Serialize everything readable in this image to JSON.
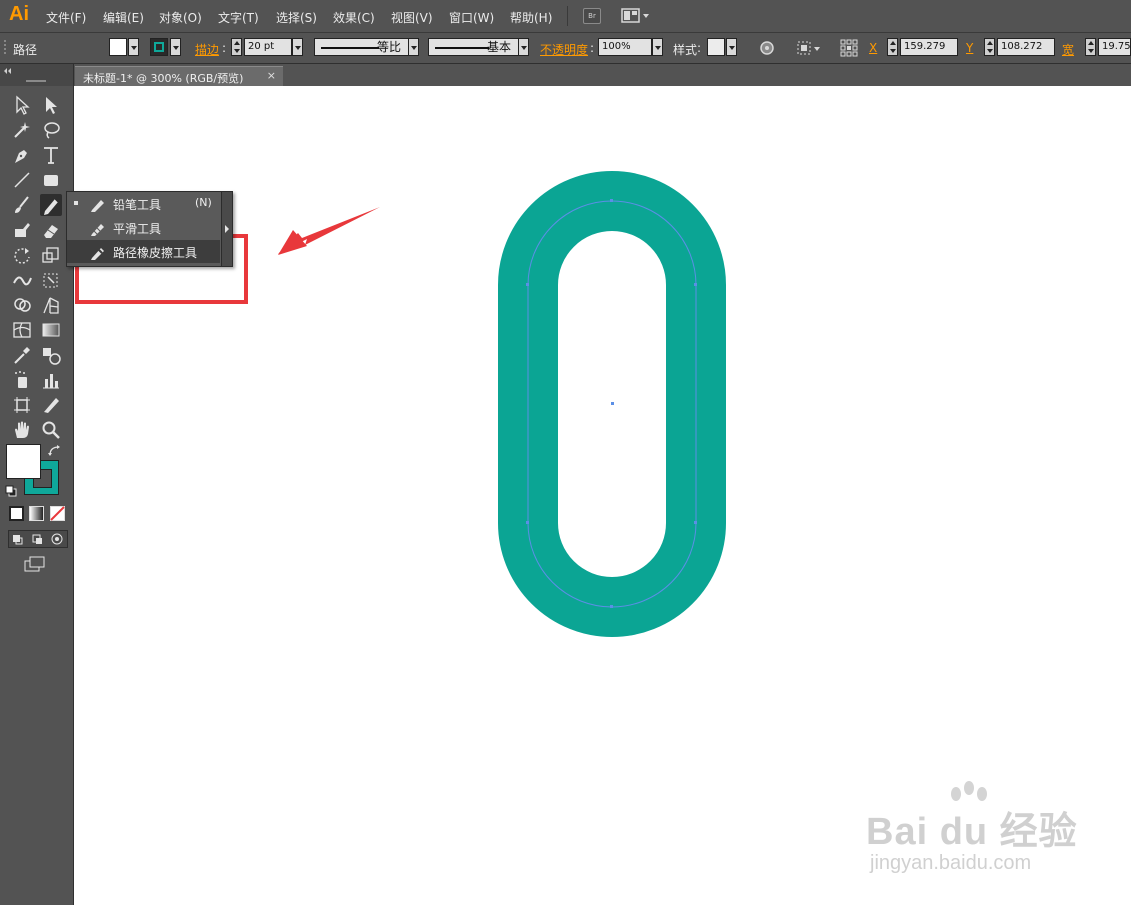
{
  "app": {
    "logo": "Ai"
  },
  "menubar": {
    "items": [
      "文件(F)",
      "编辑(E)",
      "对象(O)",
      "文字(T)",
      "选择(S)",
      "效果(C)",
      "视图(V)",
      "窗口(W)",
      "帮助(H)"
    ],
    "bridge_label": "Br"
  },
  "controlbar": {
    "selection_label": "路径",
    "stroke_label": "描边",
    "stroke_weight": "20 pt",
    "stroke_profile": "等比",
    "brush_label": "基本",
    "opacity_label": "不透明度",
    "opacity_value": "100%",
    "style_label": "样式",
    "x_label": "X",
    "x_value": "159.279",
    "y_label": "Y",
    "y_value": "108.272",
    "w_label": "宽",
    "w_value": "19.75",
    "fill_color": "#ffffff",
    "stroke_color": "#0fa89a"
  },
  "document": {
    "tab_title": "未标题-1* @ 300% (RGB/预览)",
    "close_glyph": "×"
  },
  "canvas": {
    "shape_stroke_color": "#0ba594",
    "path_color": "#5b8fe6"
  },
  "flyout": {
    "items": [
      {
        "label": "铅笔工具",
        "shortcut": "(N)",
        "icon": "pencil-icon",
        "selected": true
      },
      {
        "label": "平滑工具",
        "shortcut": "",
        "icon": "smooth-tool-icon",
        "selected": false
      },
      {
        "label": "路径橡皮擦工具",
        "shortcut": "",
        "icon": "path-eraser-icon",
        "selected": false
      }
    ]
  },
  "tools": {
    "fill_color": "#ffffff",
    "stroke_color": "#0fa89a"
  },
  "annotation": {
    "highlight_color": "#e8383b"
  },
  "watermark": {
    "brand": "Bai du 经验",
    "url": "jingyan.baidu.com"
  }
}
